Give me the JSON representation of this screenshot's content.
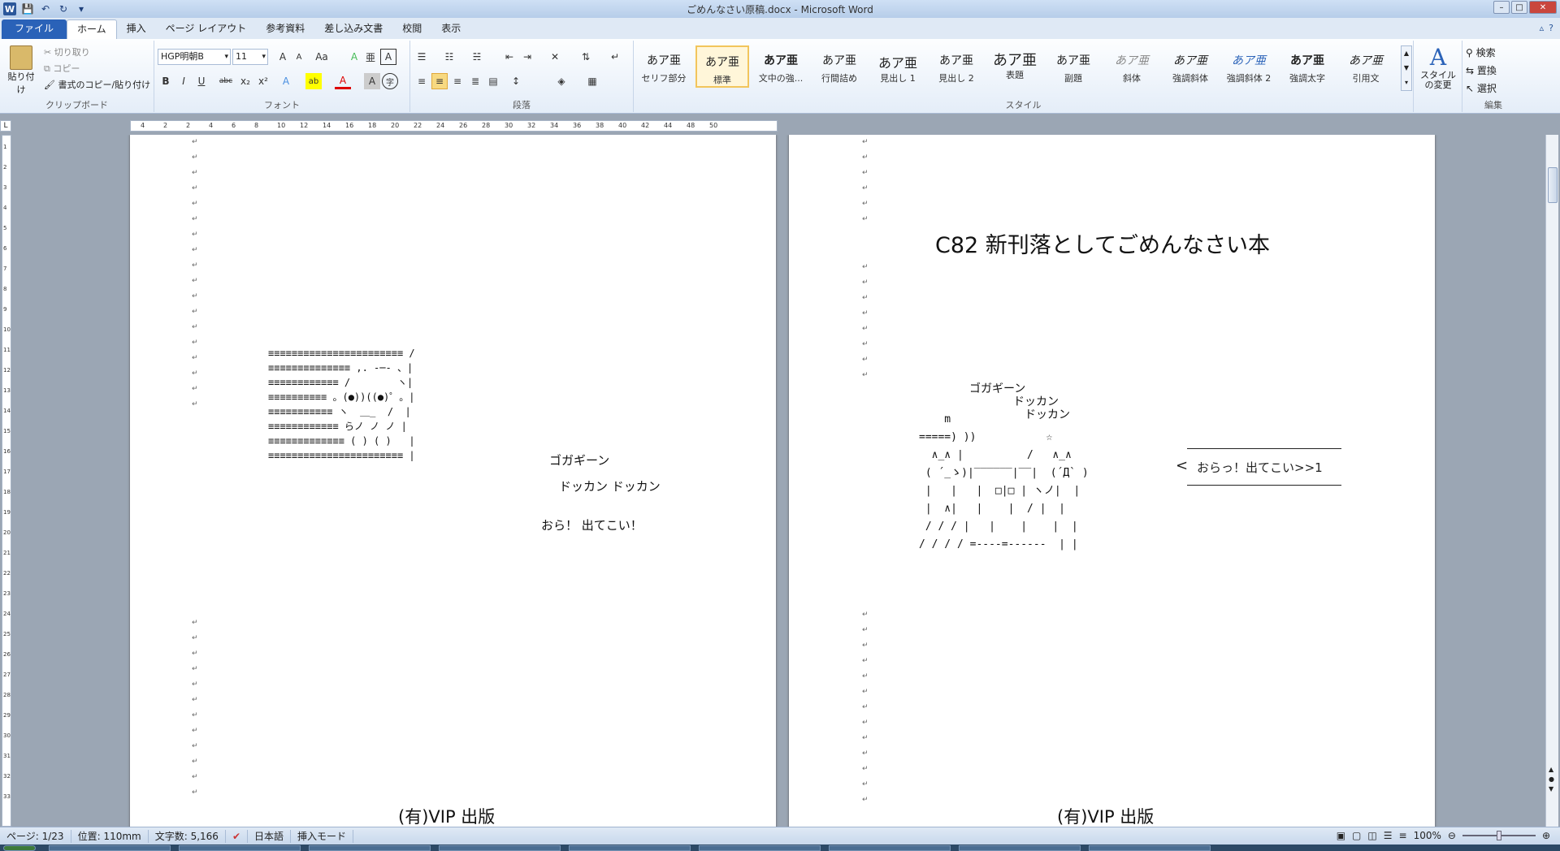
{
  "window": {
    "title": "ごめんなさい原稿.docx - Microsoft Word",
    "minimize": "–",
    "maximize": "□",
    "close": "✕"
  },
  "qat": {
    "word": "W",
    "save": "💾",
    "undo": "↶",
    "redo": "↻",
    "customize": "▾"
  },
  "tabs": [
    "ファイル",
    "ホーム",
    "挿入",
    "ページ レイアウト",
    "参考資料",
    "差し込み文書",
    "校閲",
    "表示"
  ],
  "help": {
    "minimize_ribbon": "▵",
    "help": "?"
  },
  "clipboard": {
    "paste": "貼り付け",
    "cut": "切り取り",
    "copy": "コピー",
    "format_painter": "書式のコピー/貼り付け",
    "label": "クリップボード"
  },
  "font": {
    "name": "HGP明朝B",
    "size": "11",
    "grow": "A",
    "shrink": "A",
    "case": "Aa",
    "clear": "A",
    "ruby": "亜",
    "border": "A",
    "bold": "B",
    "italic": "I",
    "underline": "U",
    "strike": "abc",
    "sub": "x₂",
    "sup": "x²",
    "effects": "A",
    "highlight": "ab",
    "color": "A",
    "shade": "A",
    "enclose": "字",
    "label": "フォント"
  },
  "paragraph": {
    "label": "段落"
  },
  "styles": {
    "label": "スタイル",
    "items": [
      {
        "preview": "あア亜",
        "name": "セリフ部分"
      },
      {
        "preview": "あア亜",
        "name": "標準"
      },
      {
        "preview": "あア亜",
        "name": "文中の強..."
      },
      {
        "preview": "あア亜",
        "name": "行間詰め"
      },
      {
        "preview": "あア亜",
        "name": "見出し 1"
      },
      {
        "preview": "あア亜",
        "name": "見出し 2"
      },
      {
        "preview": "あア亜",
        "name": "表題"
      },
      {
        "preview": "あア亜",
        "name": "副題"
      },
      {
        "preview": "あア亜",
        "name": "斜体"
      },
      {
        "preview": "あア亜",
        "name": "強調斜体"
      },
      {
        "preview": "あア亜",
        "name": "強調斜体 2"
      },
      {
        "preview": "あア亜",
        "name": "強調太字"
      },
      {
        "preview": "あア亜",
        "name": "引用文"
      }
    ],
    "change": "スタイルの変更"
  },
  "editing": {
    "find": "検索",
    "replace": "置換",
    "select": "選択",
    "label": "編集"
  },
  "ruler": {
    "corner": "L",
    "ticks": [
      "4",
      "2",
      "2",
      "4",
      "6",
      "8",
      "10",
      "12",
      "14",
      "16",
      "18",
      "20",
      "22",
      "24",
      "26",
      "28",
      "30",
      "32",
      "34",
      "36",
      "38",
      "40",
      "42",
      "44",
      "48",
      "50"
    ],
    "vticks": [
      "1",
      "2",
      "3",
      "4",
      "5",
      "6",
      "7",
      "8",
      "9",
      "10",
      "11",
      "12",
      "13",
      "14",
      "15",
      "16",
      "17",
      "18",
      "19",
      "20",
      "21",
      "22",
      "23",
      "24",
      "25",
      "26",
      "27",
      "28",
      "29",
      "30",
      "31",
      "32",
      "33"
    ]
  },
  "page1": {
    "aa_lines": [
      "≡≡≡≡≡≡≡≡≡≡≡≡≡≡≡≡≡≡≡≡≡≡≡ /",
      "≡≡≡≡≡≡≡≡≡≡≡≡≡≡ ,. -─- 、|",
      "≡≡≡≡≡≡≡≡≡≡≡≡ /        ヽ|",
      "≡≡≡≡≡≡≡≡≡≡ 。(●))((●)゜。|",
      "≡≡≡≡≡≡≡≡≡≡≡ ヽ  ＿_  /  |",
      "≡≡≡≡≡≡≡≡≡≡≡≡ らノ ノ ノ |",
      "≡≡≡≡≡≡≡≡≡≡≡≡≡ ( ) ( )   |",
      "≡≡≡≡≡≡≡≡≡≡≡≡≡≡≡≡≡≡≡≡≡≡≡ |"
    ],
    "sfx1": "ゴガギーン",
    "sfx2": "ドッカン ドッカン",
    "shout": "おら！ 出てこい！",
    "footer": "(有)VIP 出版"
  },
  "page2": {
    "title": "C82 新刊落としてごめんなさい本",
    "sfx1": "ゴガギーン",
    "sfx2": "ドッカン",
    "sfx3": "ドッカン",
    "aa_lines": [
      "    m",
      "=====) ))           ☆",
      "  ∧_∧ |          /   ∧_∧",
      " ( ´_ゝ)|‾‾‾‾‾‾|‾‾|  (´Д` )",
      " |   |   |  □|□ | ヽノ|  |",
      " |  ∧|   |    |  / |  |",
      " / / / |   |    |    |  |",
      "/ / / / =----=------  | |"
    ],
    "speech": "おらっ！出てこい>>1",
    "footer": "(有)VIP 出版"
  },
  "status": {
    "page": "ページ: 1/23",
    "position": "位置: 110mm",
    "words": "文字数: 5,166",
    "lang": "日本語",
    "mode": "挿入モード",
    "zoom": "100%"
  },
  "colors": {
    "accent": "#2a62b8",
    "style_selected": "#f2c55c"
  }
}
